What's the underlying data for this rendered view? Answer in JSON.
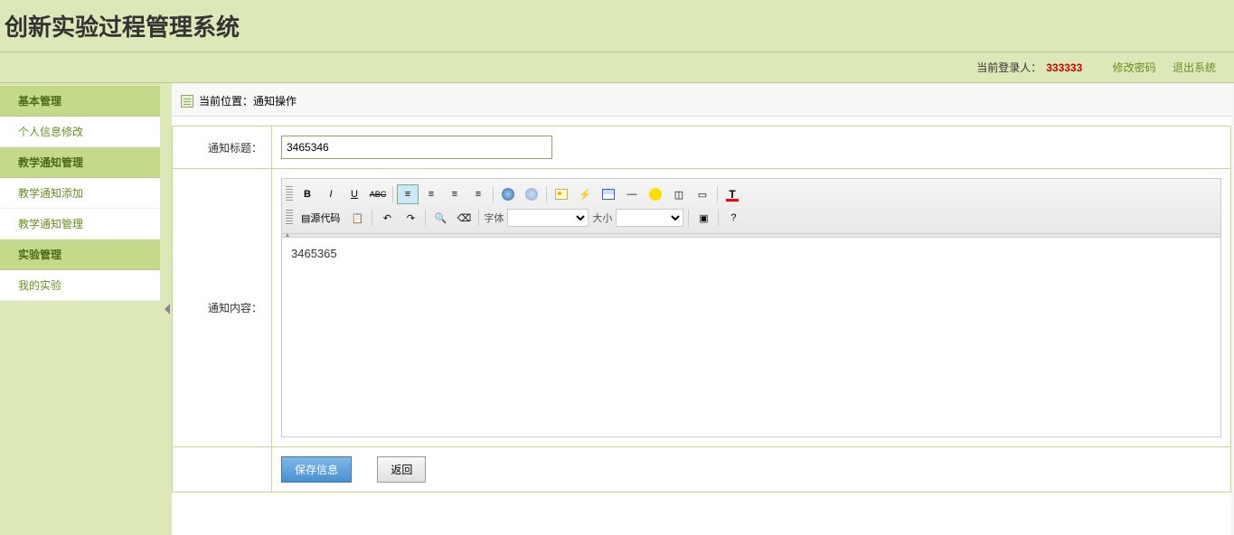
{
  "header": {
    "title": "创新实验过程管理系统"
  },
  "topbar": {
    "current_user_label": "当前登录人：",
    "username": "333333",
    "change_password": "修改密码",
    "logout": "退出系统"
  },
  "sidebar": {
    "groups": [
      {
        "header": "基本管理",
        "items": [
          "个人信息修改"
        ]
      },
      {
        "header": "教学通知管理",
        "items": [
          "教学通知添加",
          "教学通知管理"
        ]
      },
      {
        "header": "实验管理",
        "items": [
          "我的实验"
        ]
      }
    ]
  },
  "breadcrumb": {
    "label": "当前位置：通知操作"
  },
  "form": {
    "title_label": "通知标题：",
    "title_value": "3465346",
    "content_label": "通知内容：",
    "content_value": "3465365"
  },
  "editor_toolbar": {
    "source_btn": "源代码",
    "font_label": "字体",
    "size_label": "大小"
  },
  "buttons": {
    "save": "保存信息",
    "back": "返回"
  }
}
